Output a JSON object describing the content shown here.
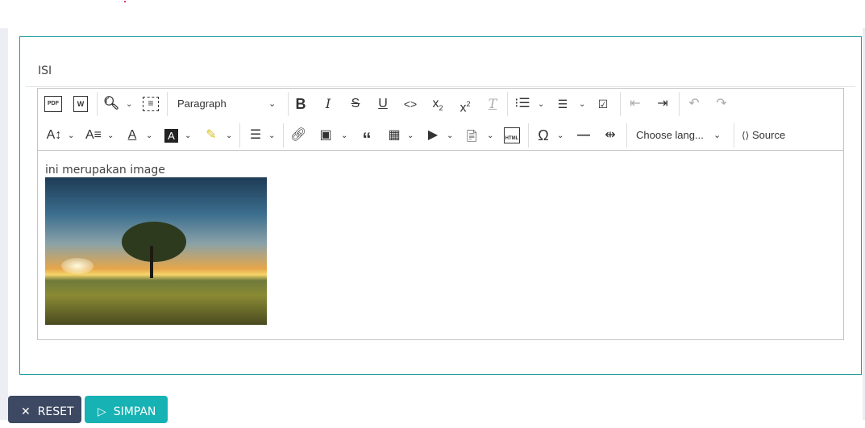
{
  "form": {
    "label": "ISI"
  },
  "toolbar": {
    "paragraph": "Paragraph",
    "language": "Choose lang...",
    "source": "Source",
    "pdf": "PDF",
    "word": "W",
    "html": "HTML"
  },
  "editor": {
    "text": "ini merupakan image"
  },
  "buttons": {
    "reset": "RESET",
    "simpan": "SIMPAN",
    "reset_icon": "✕",
    "simpan_icon": "▷"
  }
}
